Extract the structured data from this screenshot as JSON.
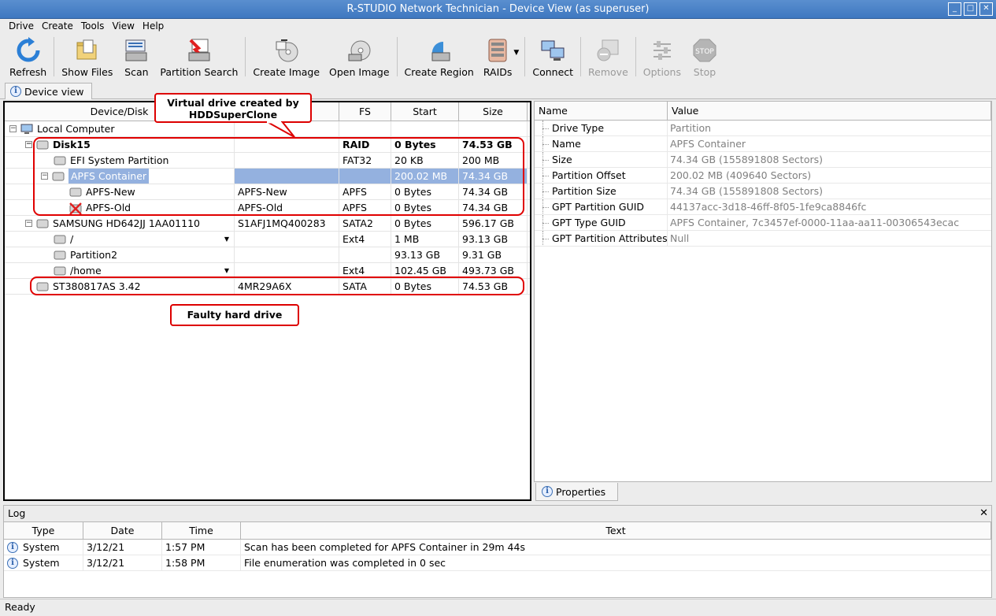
{
  "window": {
    "title": "R-STUDIO Network Technician - Device View (as superuser)"
  },
  "menu": [
    "Drive",
    "Create",
    "Tools",
    "View",
    "Help"
  ],
  "toolbar": {
    "refresh": "Refresh",
    "show_files": "Show Files",
    "scan": "Scan",
    "partition_search": "Partition Search",
    "create_image": "Create Image",
    "open_image": "Open Image",
    "create_region": "Create Region",
    "raids": "RAIDs",
    "connect": "Connect",
    "remove": "Remove",
    "options": "Options",
    "stop": "Stop"
  },
  "tabs": {
    "device_view": "Device view",
    "properties": "Properties"
  },
  "device_table": {
    "columns": [
      "Device/Disk",
      "",
      "FS",
      "Start",
      "Size"
    ],
    "rows": [
      {
        "name": "Local Computer",
        "serial": "",
        "fs": "",
        "start": "",
        "size": ""
      },
      {
        "name": "Disk15",
        "serial": "",
        "fs": "RAID",
        "start": "0 Bytes",
        "size": "74.53 GB"
      },
      {
        "name": "EFI System Partition",
        "serial": "",
        "fs": "FAT32",
        "start": "20 KB",
        "size": "200 MB"
      },
      {
        "name": "APFS Container",
        "serial": "",
        "fs": "",
        "start": "200.02 MB",
        "size": "74.34 GB"
      },
      {
        "name": "APFS-New",
        "serial": "APFS-New",
        "fs": "APFS",
        "start": "0 Bytes",
        "size": "74.34 GB"
      },
      {
        "name": "APFS-Old",
        "serial": "APFS-Old",
        "fs": "APFS",
        "start": "0 Bytes",
        "size": "74.34 GB"
      },
      {
        "name": "SAMSUNG HD642JJ 1AA01110",
        "serial": "S1AFJ1MQ400283",
        "fs": "SATA2",
        "start": "0 Bytes",
        "size": "596.17 GB"
      },
      {
        "name": "/",
        "serial": "",
        "fs": "Ext4",
        "start": "1 MB",
        "size": "93.13 GB"
      },
      {
        "name": "Partition2",
        "serial": "",
        "fs": "",
        "start": "93.13 GB",
        "size": "9.31 GB"
      },
      {
        "name": "/home",
        "serial": "",
        "fs": "Ext4",
        "start": "102.45 GB",
        "size": "493.73 GB"
      },
      {
        "name": "ST380817AS 3.42",
        "serial": "4MR29A6X",
        "fs": "SATA",
        "start": "0 Bytes",
        "size": "74.53 GB"
      }
    ]
  },
  "annotations": {
    "virtual_drive": "Virtual drive created by HDDSuperClone",
    "faulty_drive": "Faulty hard drive"
  },
  "properties": {
    "columns": [
      "Name",
      "Value"
    ],
    "rows": [
      {
        "name": "Drive Type",
        "value": "Partition"
      },
      {
        "name": "Name",
        "value": "APFS Container"
      },
      {
        "name": "Size",
        "value": "74.34 GB (155891808 Sectors)"
      },
      {
        "name": "Partition Offset",
        "value": "200.02 MB (409640 Sectors)"
      },
      {
        "name": "Partition Size",
        "value": "74.34 GB (155891808 Sectors)"
      },
      {
        "name": "GPT Partition GUID",
        "value": "44137acc-3d18-46ff-8f05-1fe9ca8846fc"
      },
      {
        "name": "GPT Type GUID",
        "value": "APFS Container, 7c3457ef-0000-11aa-aa11-00306543ecac"
      },
      {
        "name": "GPT Partition Attributes",
        "value": "Null"
      }
    ]
  },
  "log": {
    "title": "Log",
    "columns": [
      "Type",
      "Date",
      "Time",
      "Text"
    ],
    "rows": [
      {
        "type": "System",
        "date": "3/12/21",
        "time": "1:57 PM",
        "text": "Scan has been completed for APFS Container in 29m 44s"
      },
      {
        "type": "System",
        "date": "3/12/21",
        "time": "1:58 PM",
        "text": "File enumeration was completed in 0 sec"
      }
    ]
  },
  "status": "Ready",
  "colors": {
    "title_bar": "#3e78c0",
    "selection": "#94b1df",
    "annotation_red": "#e00000"
  }
}
